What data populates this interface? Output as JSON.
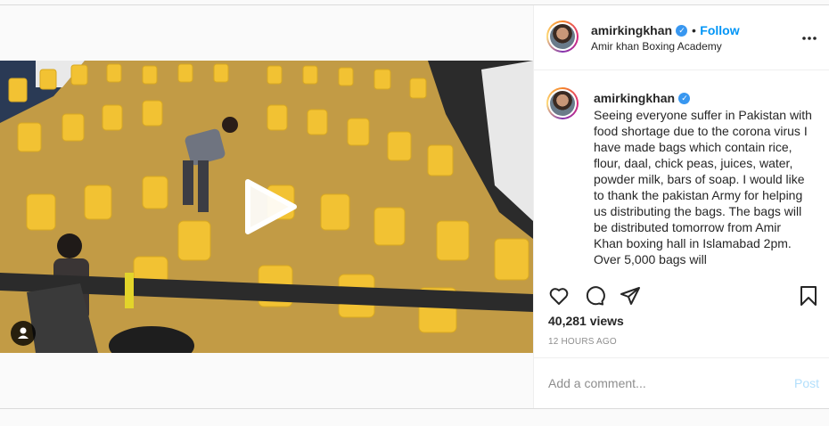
{
  "header": {
    "username": "amirkingkhan",
    "separator": "•",
    "follow_label": "Follow",
    "subtitle": "Amir khan Boxing Academy",
    "more_icon": "more-horizontal-icon"
  },
  "caption": {
    "username": "amirkingkhan",
    "text": "Seeing everyone suffer in Pakistan with food shortage due to the corona virus I have made bags which contain rice, flour, daal, chick peas, juices, water, powder milk, bars of soap. I would like to thank the pakistan Army for helping us distributing the bags. The bags will be distributed tomorrow from Amir Khan boxing hall in Islamabad 2pm. Over 5,000 bags will"
  },
  "actions": {
    "like_icon": "heart-icon",
    "comment_icon": "comment-icon",
    "share_icon": "send-icon",
    "save_icon": "bookmark-icon"
  },
  "stats": {
    "views": "40,281 views",
    "time_ago": "12 HOURS AGO"
  },
  "comment_box": {
    "placeholder": "Add a comment...",
    "post_label": "Post"
  },
  "video": {
    "play_icon": "play-icon",
    "user_icon": "tagged-user-icon"
  },
  "colors": {
    "accent": "#0095f6",
    "verified": "#3897f0",
    "bags": "#f2c233",
    "floor": "#c9a24a"
  }
}
